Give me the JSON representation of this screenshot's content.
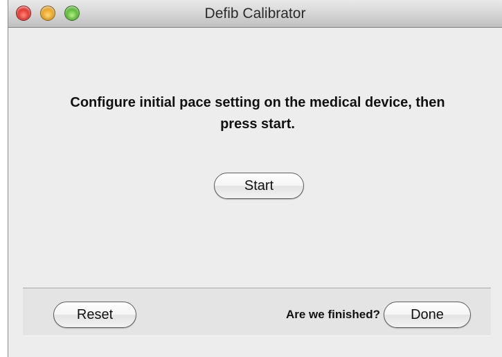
{
  "window": {
    "title": "Defib Calibrator"
  },
  "main": {
    "message": "Configure initial pace setting on the medical device, then press start.",
    "start_label": "Start"
  },
  "footer": {
    "reset_label": "Reset",
    "finished_prompt": "Are we finished?",
    "done_label": "Done"
  },
  "colors": {
    "close_button": "#e0302a",
    "minimize_button": "#e9a21c",
    "zoom_button": "#55b630",
    "window_background": "#ededed"
  }
}
